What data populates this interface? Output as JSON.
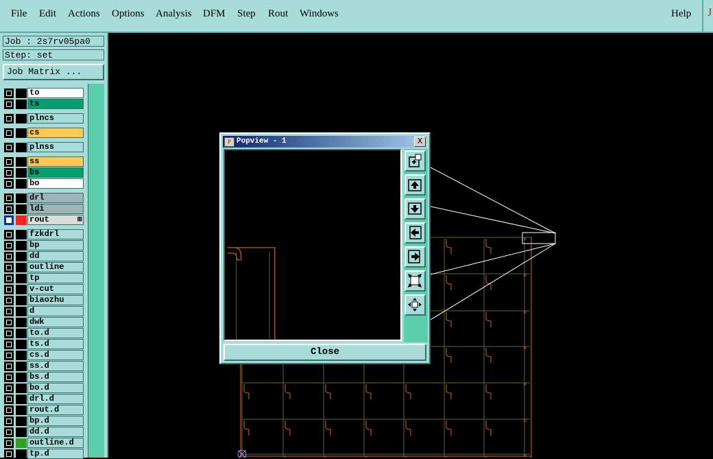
{
  "menubar": {
    "items": [
      {
        "label": "File"
      },
      {
        "label": "Edit"
      },
      {
        "label": "Actions"
      },
      {
        "label": "Options"
      },
      {
        "label": "Analysis"
      },
      {
        "label": "DFM"
      },
      {
        "label": "Step"
      },
      {
        "label": "Rout"
      },
      {
        "label": "Windows"
      }
    ],
    "help": "Help"
  },
  "sidebar": {
    "job": "Job : 2s7rv05pa0",
    "step": "Step: set",
    "job_matrix": "Job Matrix ..."
  },
  "layers": [
    {
      "name": "to",
      "color": "#ffffff"
    },
    {
      "name": "ts",
      "color": "#00a070"
    },
    {
      "name": "plncs",
      "color": "#a7dcd9"
    },
    {
      "name": "cs",
      "color": "#ffc850"
    },
    {
      "name": "plnss",
      "color": "#a7dcd9"
    },
    {
      "name": "ss",
      "color": "#ffc850"
    },
    {
      "name": "bs",
      "color": "#00a070"
    },
    {
      "name": "bo",
      "color": "#ffffff"
    },
    {
      "name": "drl",
      "color": "#a0b4b8"
    },
    {
      "name": "ldi",
      "color": "#a0b4b8"
    },
    {
      "name": "rout",
      "color": "#dcdcdc",
      "selected": true,
      "swatch": "#ff2020"
    },
    {
      "name": "fzkdrl",
      "color": "#a7dcd9"
    },
    {
      "name": "bp",
      "color": "#a7dcd9"
    },
    {
      "name": "dd",
      "color": "#a7dcd9"
    },
    {
      "name": "outline",
      "color": "#a7dcd9"
    },
    {
      "name": "tp",
      "color": "#a7dcd9"
    },
    {
      "name": "v-cut",
      "color": "#a7dcd9"
    },
    {
      "name": "biaozhu",
      "color": "#a7dcd9"
    },
    {
      "name": "d",
      "color": "#a7dcd9"
    },
    {
      "name": "dwk",
      "color": "#a7dcd9"
    },
    {
      "name": "to.d",
      "color": "#a7dcd9"
    },
    {
      "name": "ts.d",
      "color": "#a7dcd9"
    },
    {
      "name": "cs.d",
      "color": "#a7dcd9"
    },
    {
      "name": "ss.d",
      "color": "#a7dcd9"
    },
    {
      "name": "bs.d",
      "color": "#a7dcd9"
    },
    {
      "name": "bo.d",
      "color": "#a7dcd9"
    },
    {
      "name": "drl.d",
      "color": "#a7dcd9"
    },
    {
      "name": "rout.d",
      "color": "#a7dcd9"
    },
    {
      "name": "bp.d",
      "color": "#a7dcd9"
    },
    {
      "name": "dd.d",
      "color": "#a7dcd9"
    },
    {
      "name": "outline.d",
      "color": "#a7dcd9",
      "swatch": "#30a020"
    },
    {
      "name": "tp.d",
      "color": "#a7dcd9"
    }
  ],
  "popview": {
    "title": "Popview - 1",
    "close_x": "X",
    "close_button": "Close",
    "tools": [
      "zoom-window-icon",
      "pan-up-icon",
      "pan-down-icon",
      "pan-left-icon",
      "pan-right-icon",
      "zoom-in-icon",
      "zoom-out-icon"
    ]
  },
  "colors": {
    "panel": "#a7dcd9",
    "accent": "#5bcfad",
    "outline": "#e0602a",
    "grid": "#556b2f"
  }
}
